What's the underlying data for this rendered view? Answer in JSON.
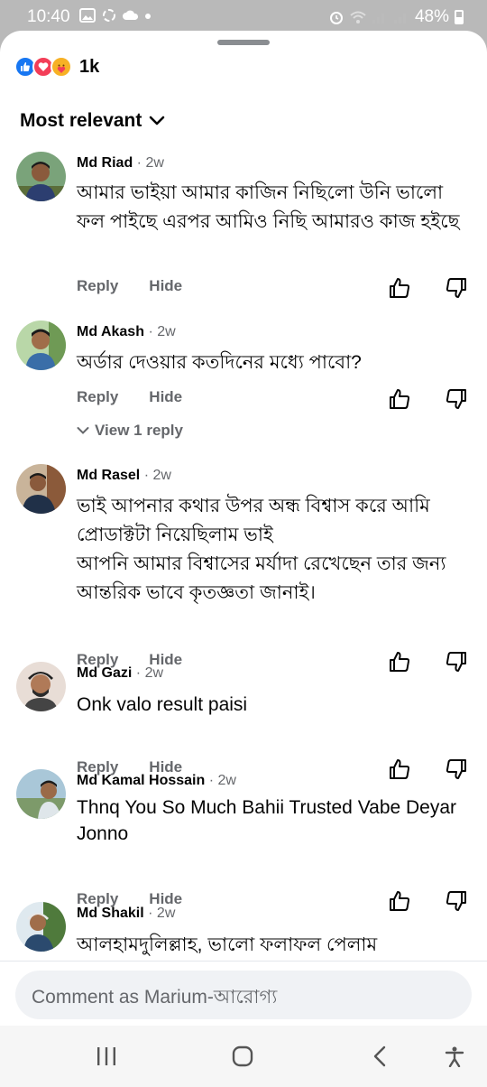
{
  "status_bar": {
    "time": "10:40",
    "battery": "48%"
  },
  "reactions": {
    "types": [
      "like-icon",
      "love-icon",
      "care-icon"
    ],
    "count": "1k"
  },
  "sort": {
    "label": "Most relevant"
  },
  "comments": [
    {
      "name": "Md Riad",
      "time": "· 2w",
      "text": "আমার ভাইয়া আমার কাজিন নিছিলো উনি ভালো ফল পাইছে এরপর আমিও নিছি আমারও কাজ হইছে",
      "reply": "Reply",
      "hide": "Hide"
    },
    {
      "name": "Md Akash",
      "time": "· 2w",
      "text": "অর্ডার দেওয়ার কতদিনের মধ্যে পাবো?",
      "reply": "Reply",
      "hide": "Hide",
      "view_replies": "View 1 reply"
    },
    {
      "name": "Md Rasel",
      "time": "· 2w",
      "text": "ভাই আপনার কথার উপর অন্ধ বিশ্বাস করে আমি প্রোডাক্টটা নিয়েছিলাম ভাই",
      "text2": "আপনি আমার বিশ্বাসের মর্যাদা রেখেছেন তার জন্য আন্তরিক ভাবে কৃতজ্ঞতা জানাই।",
      "reply": "Reply",
      "hide": "Hide"
    },
    {
      "name": "Md Gazi",
      "time": "· 2w",
      "text": "Onk valo result paisi",
      "reply": "Reply",
      "hide": "Hide"
    },
    {
      "name": "Md Kamal Hossain",
      "time": "· 2w",
      "text": "Thnq You So Much Bahii Trusted Vabe Deyar Jonno",
      "reply": "Reply",
      "hide": "Hide"
    },
    {
      "name": "Md Shakil",
      "time": "· 2w",
      "text": "আলহামদুলিল্লাহ,  ভালো ফলাফল পেলাম"
    }
  ],
  "composer": {
    "placeholder": "Comment as Marium-আরোগ্য"
  },
  "colors": {
    "accent": "#1877f2",
    "secondary_text": "#65676b"
  }
}
